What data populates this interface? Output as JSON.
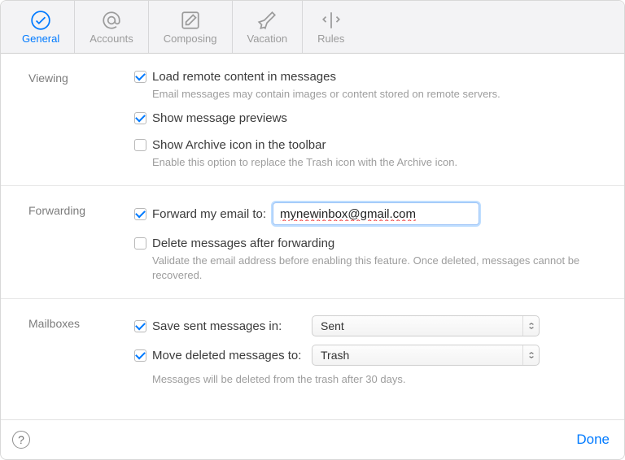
{
  "tabs": {
    "general": {
      "label": "General"
    },
    "accounts": {
      "label": "Accounts"
    },
    "composing": {
      "label": "Composing"
    },
    "vacation": {
      "label": "Vacation"
    },
    "rules": {
      "label": "Rules"
    }
  },
  "viewing": {
    "heading": "Viewing",
    "loadRemote": {
      "label": "Load remote content in messages",
      "checked": true
    },
    "loadRemoteHelp": "Email messages may contain images or content stored on remote servers.",
    "showPreviews": {
      "label": "Show message previews",
      "checked": true
    },
    "showArchive": {
      "label": "Show Archive icon in the toolbar",
      "checked": false
    },
    "showArchiveHelp": "Enable this option to replace the Trash icon with the Archive icon."
  },
  "forwarding": {
    "heading": "Forwarding",
    "forward": {
      "label": "Forward my email to:",
      "checked": true,
      "value": "mynewinbox@gmail.com"
    },
    "deleteAfter": {
      "label": "Delete messages after forwarding",
      "checked": false
    },
    "help": "Validate the email address before enabling this feature. Once deleted, messages cannot be recovered."
  },
  "mailboxes": {
    "heading": "Mailboxes",
    "saveSent": {
      "label": "Save sent messages in:",
      "checked": true,
      "value": "Sent"
    },
    "moveDeleted": {
      "label": "Move deleted messages to:",
      "checked": true,
      "value": "Trash"
    },
    "help": "Messages will be deleted from the trash after 30 days."
  },
  "footer": {
    "done": "Done",
    "help": "?"
  }
}
